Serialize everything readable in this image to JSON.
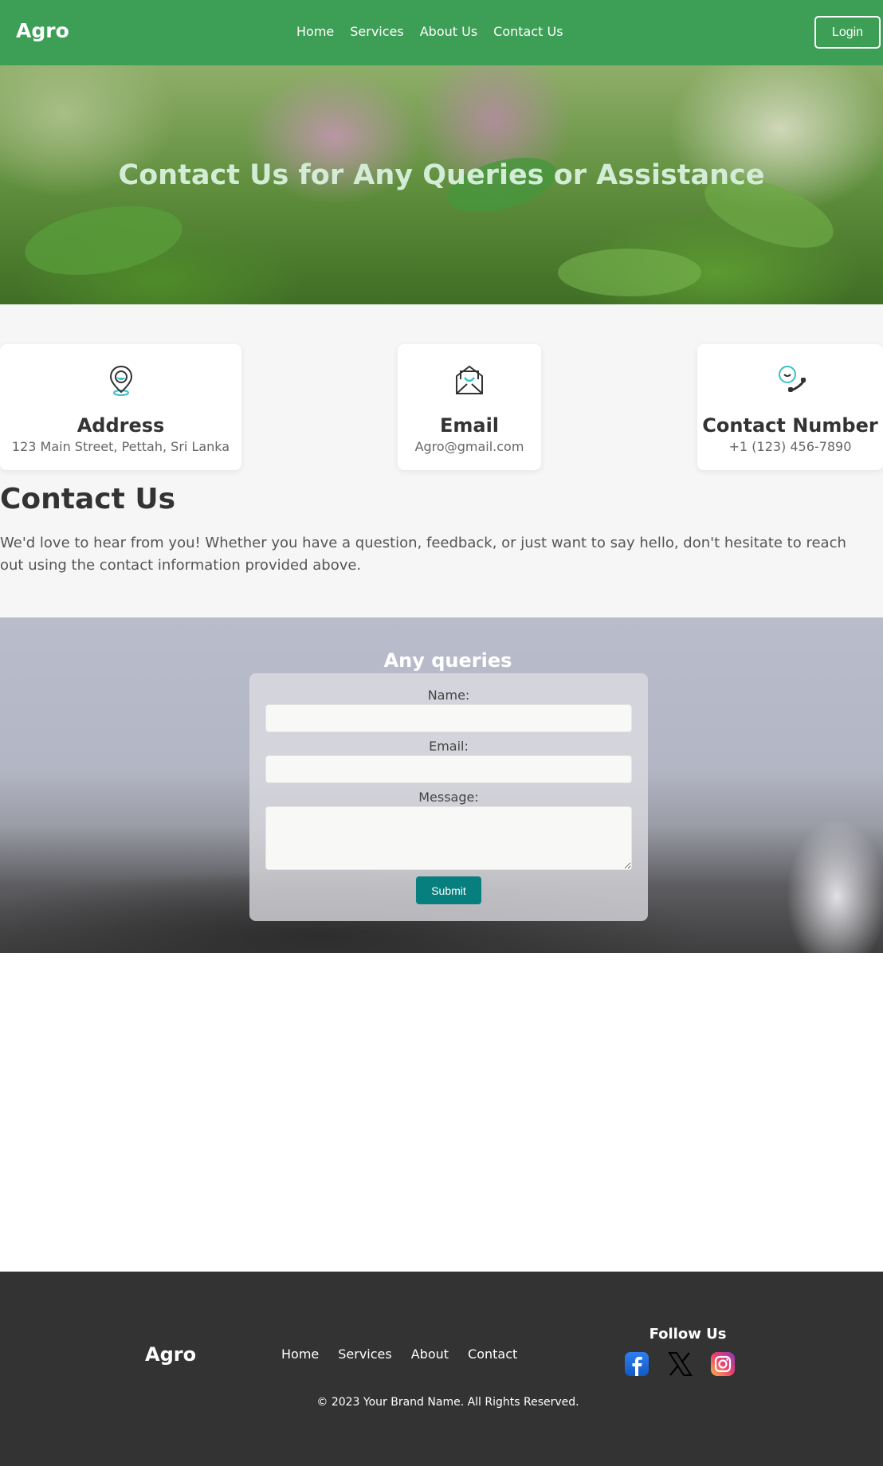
{
  "nav": {
    "brand": "Agro",
    "links": [
      "Home",
      "Services",
      "About Us",
      "Contact Us"
    ],
    "login_label": "Login"
  },
  "hero": {
    "title": "Contact Us for Any Queries or Assistance"
  },
  "cards": [
    {
      "icon": "location-pin-icon",
      "title": "Address",
      "value": "123 Main Street, Pettah, Sri Lanka"
    },
    {
      "icon": "envelope-icon",
      "title": "Email",
      "value": "Agro@gmail.com"
    },
    {
      "icon": "phone-icon",
      "title": "Contact Number",
      "value": "+1 (123) 456-7890"
    }
  ],
  "contact": {
    "heading": "Contact Us",
    "text": "We'd love to hear from you! Whether you have a question, feedback, or just want to say hello, don't hesitate to reach out using the contact information provided above."
  },
  "form": {
    "title": "Any queries",
    "name_label": "Name:",
    "name_value": "",
    "email_label": "Email:",
    "email_value": "",
    "message_label": "Message:",
    "message_value": "",
    "submit_label": "Submit"
  },
  "footer": {
    "brand": "Agro",
    "links": [
      "Home",
      "Services",
      "About",
      "Contact"
    ],
    "follow_label": "Follow Us",
    "social": [
      "facebook-icon",
      "x-icon",
      "instagram-icon"
    ],
    "copyright": "© 2023 Your Brand Name. All Rights Reserved."
  },
  "colors": {
    "nav_bg": "#3d9e55",
    "submit_bg": "#087f7f",
    "footer_bg": "#333333"
  }
}
